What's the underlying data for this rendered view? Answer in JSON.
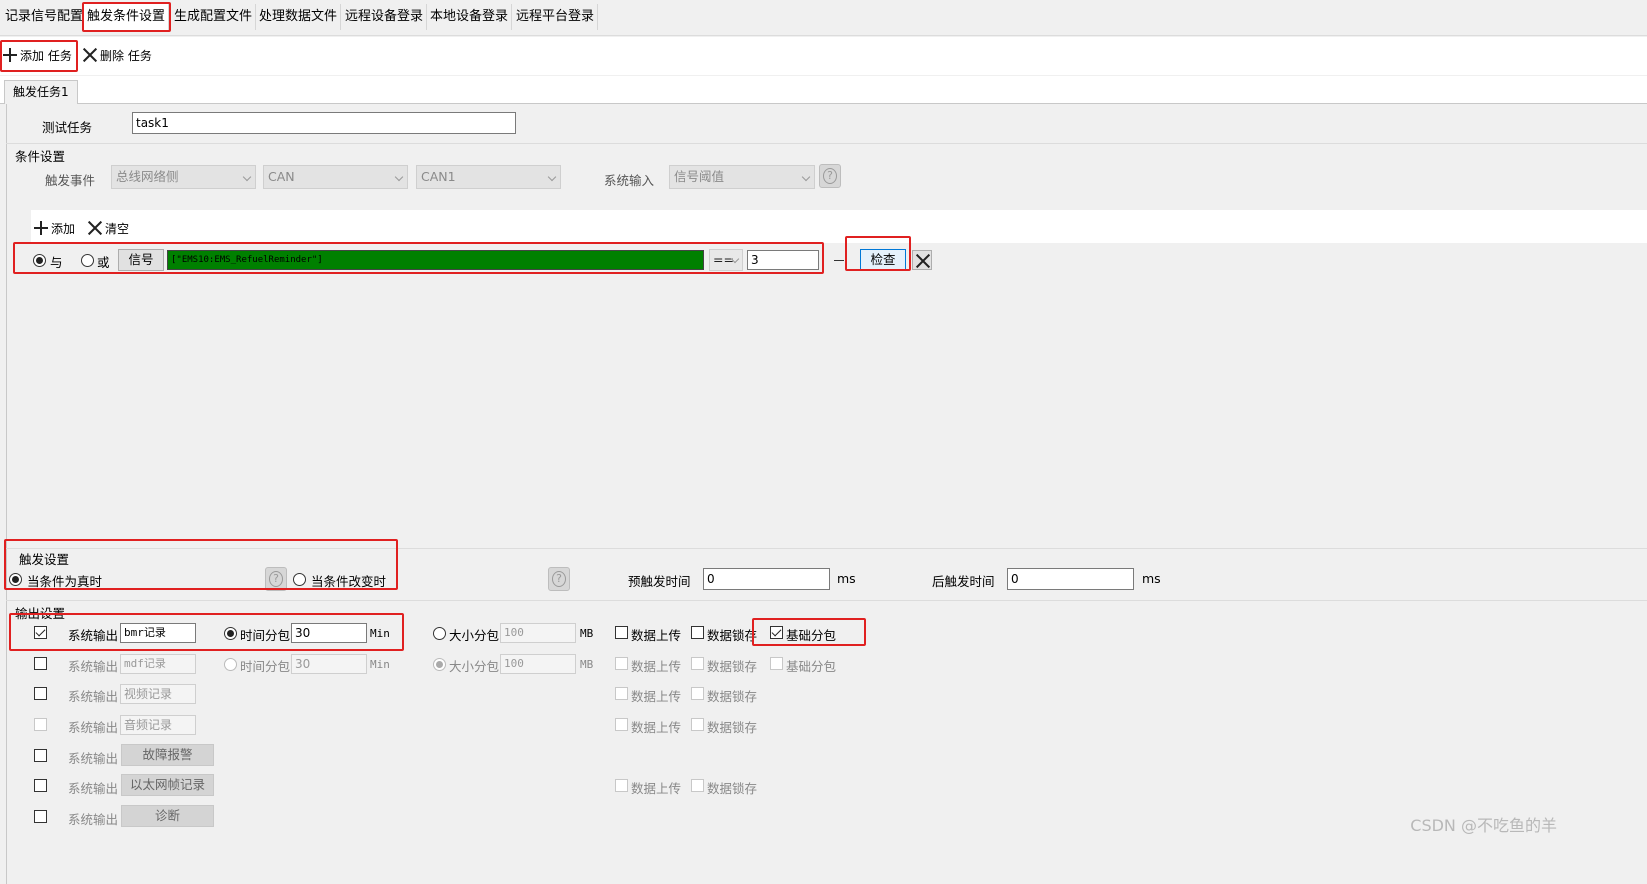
{
  "top_tabs": [
    {
      "label": "记录信号配置"
    },
    {
      "label": "触发条件设置"
    },
    {
      "label": "生成配置文件"
    },
    {
      "label": "处理数据文件"
    },
    {
      "label": "远程设备登录"
    },
    {
      "label": "本地设备登录"
    },
    {
      "label": "远程平台登录"
    }
  ],
  "toolbar": {
    "add_task": "添加 任务",
    "delete_task": "删除 任务"
  },
  "sub_tab": {
    "label": "触发任务1"
  },
  "task": {
    "name_label": "测试任务",
    "name_value": "task1"
  },
  "condition_settings": {
    "title": "条件设置",
    "trigger_event_label": "触发事件",
    "trigger_event_value": "总线网络侧",
    "bus_value": "CAN",
    "channel_value": "CAN1",
    "system_input_label": "系统输入",
    "system_input_value": "信号阈值",
    "help": "?",
    "add_label": "添加",
    "clear_label": "清空",
    "row": {
      "and_label": "与",
      "or_label": "或",
      "signal_button": "信号",
      "signal_value": "[\"EMS10:EMS_RefuelReminder\"]",
      "operator": "==",
      "threshold": "3",
      "check_button": "检查"
    }
  },
  "trigger_settings": {
    "title": "触发设置",
    "when_true": "当条件为真时",
    "when_changed": "当条件改变时",
    "pre_trigger_label": "预触发时间",
    "pre_trigger_value": "0",
    "pre_unit": "ms",
    "post_trigger_label": "后触发时间",
    "post_trigger_value": "0",
    "post_unit": "ms"
  },
  "output_settings": {
    "title": "输出设置",
    "rows": [
      {
        "sys": "系统输出",
        "name": "bmr记录",
        "time_split": "时间分包",
        "time_value": "30",
        "time_unit": "Min",
        "size_split": "大小分包",
        "size_value": "100",
        "size_unit": "MB",
        "upload": "数据上传",
        "lock": "数据锁存",
        "basic": "基础分包"
      },
      {
        "sys": "系统输出",
        "name": "mdf记录",
        "time_split": "时间分包",
        "time_value": "30",
        "time_unit": "Min",
        "size_split": "大小分包",
        "size_value": "100",
        "size_unit": "MB",
        "upload": "数据上传",
        "lock": "数据锁存",
        "basic": "基础分包"
      },
      {
        "sys": "系统输出",
        "name": "视频记录",
        "upload": "数据上传",
        "lock": "数据锁存"
      },
      {
        "sys": "系统输出",
        "name": "音频记录",
        "upload": "数据上传",
        "lock": "数据锁存"
      },
      {
        "sys": "系统输出",
        "button": "故障报警"
      },
      {
        "sys": "系统输出",
        "button": "以太网帧记录",
        "upload": "数据上传",
        "lock": "数据锁存"
      },
      {
        "sys": "系统输出",
        "button": "诊断"
      }
    ]
  },
  "watermark": "CSDN @不吃鱼的羊"
}
